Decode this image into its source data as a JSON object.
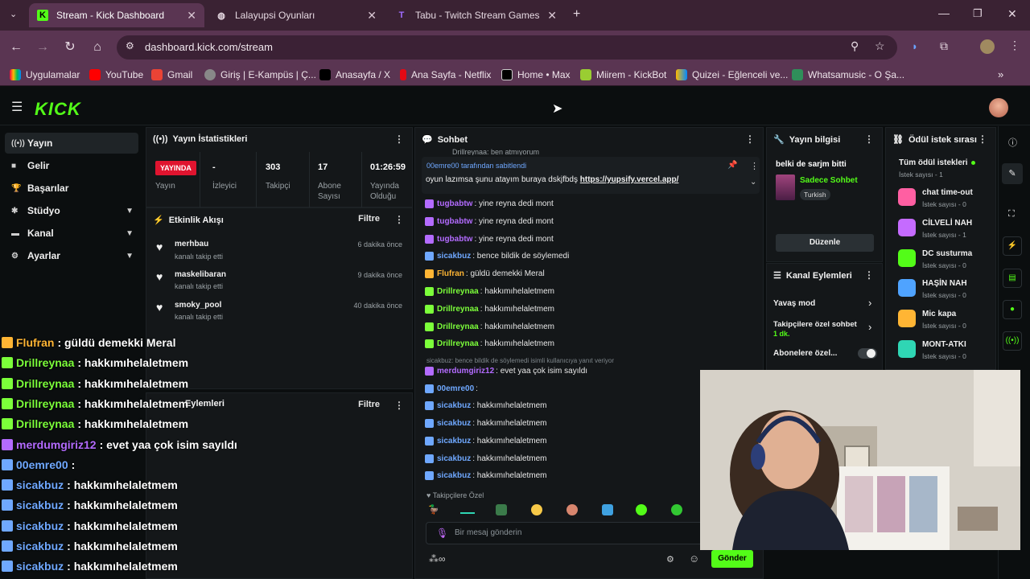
{
  "browser": {
    "tabs": [
      {
        "title": "Stream - Kick Dashboard",
        "active": true
      },
      {
        "title": "Lalayupsi Oyunları",
        "active": false
      },
      {
        "title": "Tabu - Twitch Stream Games",
        "active": false
      }
    ],
    "url": "dashboard.kick.com/stream",
    "bookmarks": [
      "Uygulamalar",
      "YouTube",
      "Gmail",
      "Giriş | E-Kampüs | Ç...",
      "Anasayfa / X",
      "Ana Sayfa - Netflix",
      "Home • Max",
      "Miirem - KickBot",
      "Quizei - Eğlenceli ve...",
      "Whatsamusic - O Şa..."
    ]
  },
  "app": {
    "logo": "KICK",
    "sidebar": [
      {
        "label": "Yayın",
        "active": true,
        "chevron": false
      },
      {
        "label": "Gelir",
        "active": false,
        "chevron": false
      },
      {
        "label": "Başarılar",
        "active": false,
        "chevron": false
      },
      {
        "label": "Stüdyo",
        "active": false,
        "chevron": true
      },
      {
        "label": "Kanal",
        "active": false,
        "chevron": true
      },
      {
        "label": "Ayarlar",
        "active": false,
        "chevron": true
      }
    ],
    "stats": {
      "title": "Yayın İstatistikleri",
      "live_badge": "YAYINDA",
      "live_label": "Yayın",
      "items": [
        {
          "value": "-",
          "label": "İzleyici"
        },
        {
          "value": "303",
          "label": "Takipçi"
        },
        {
          "value": "17",
          "label": "Abone Sayısı"
        },
        {
          "value": "01:26:59",
          "label": "Yayında Olduğu Süre"
        }
      ]
    },
    "activity": {
      "title": "Etkinlik Akışı",
      "filter": "Filtre",
      "items": [
        {
          "user": "merhbau",
          "action": "kanalı takip etti",
          "time": "6 dakika önce"
        },
        {
          "user": "maskelibaran",
          "action": "kanalı takip etti",
          "time": "9 dakika önce"
        },
        {
          "user": "smoky_pool",
          "action": "kanalı takip etti",
          "time": "40 dakika önce"
        }
      ]
    },
    "moderation": {
      "title": "Eylemleri",
      "filter": "Filtre"
    },
    "chat": {
      "title": "Sohbet",
      "top_partial": "Drillreynaa: ben atmıyorum",
      "pinned_by": "00emre00 tarafından sabitlendi",
      "pinned_text": "oyun lazımsa şunu atayım buraya dskjfbdş",
      "pinned_link": "https://yupsify.vercel.app/",
      "messages": [
        {
          "user": "tugbabtw",
          "text": ": yine reyna dedi mont",
          "color": "#b36bff"
        },
        {
          "user": "tugbabtw",
          "text": ": yine reyna dedi mont",
          "color": "#b36bff"
        },
        {
          "user": "tugbabtw",
          "text": ": yine reyna dedi mont",
          "color": "#b36bff"
        },
        {
          "user": "sicakbuz",
          "text": ": bence bildik de söylemedi",
          "color": "#6fa8ff"
        },
        {
          "user": "Flufran",
          "text": ": güldü demekki Meral",
          "color": "#ffb534"
        },
        {
          "user": "Drillreynaa",
          "text": ": hakkımıhelaletmem",
          "color": "#7cff3a"
        },
        {
          "user": "Drillreynaa",
          "text": ": hakkımıhelaletmem",
          "color": "#7cff3a"
        },
        {
          "user": "Drillreynaa",
          "text": ": hakkımıhelaletmem",
          "color": "#7cff3a"
        },
        {
          "user": "Drillreynaa",
          "text": ": hakkımıhelaletmem",
          "color": "#7cff3a"
        }
      ],
      "reply_context": "sicakbuz: bence bildik de söylemedi isimli kullanıcıya yanıt veriyor",
      "messages2": [
        {
          "user": "merdumgiriz12",
          "text": ": evet yaa çok isim sayıldı",
          "color": "#b36bff"
        },
        {
          "user": "00emre00",
          "text": ":",
          "color": "#6fa8ff"
        },
        {
          "user": "sicakbuz",
          "text": ": hakkımıhelaletmem",
          "color": "#6fa8ff"
        },
        {
          "user": "sicakbuz",
          "text": ": hakkımıhelaletmem",
          "color": "#6fa8ff"
        },
        {
          "user": "sicakbuz",
          "text": ": hakkımıhelaletmem",
          "color": "#6fa8ff"
        },
        {
          "user": "sicakbuz",
          "text": ": hakkımıhelaletmem",
          "color": "#6fa8ff"
        },
        {
          "user": "sicakbuz",
          "text": ": hakkımıhelaletmem",
          "color": "#6fa8ff"
        }
      ],
      "followers_only": "Takipçilere Özel",
      "input_placeholder": "Bir mesaj gönderin",
      "send": "Gönder"
    },
    "stream_info": {
      "title": "Yayın bilgisi",
      "stream_title": "belki de sarjm bitti",
      "category": "Sadece Sohbet",
      "tag": "Turkish",
      "edit": "Düzenle"
    },
    "channel_actions": {
      "title": "Kanal Eylemleri",
      "items": [
        "Yavaş mod",
        "Takipçilere özel sohbet",
        "Abonelere özel..."
      ],
      "follow_sub": "1 dk."
    },
    "rewards": {
      "title": "Ödül istek sırası",
      "all": "Tüm ödül istekleri",
      "all_count": "İstek sayısı - 1",
      "items": [
        {
          "name": "chat time-out",
          "count": "İstek sayısı - 0",
          "color": "#ff5fa2"
        },
        {
          "name": "CİLVELİ NAH",
          "count": "İstek sayısı - 1",
          "color": "#c56bff"
        },
        {
          "name": "DC susturma",
          "count": "İstek sayısı - 0",
          "color": "#53fc18"
        },
        {
          "name": "HAŞİN NAH",
          "count": "İstek sayısı - 0",
          "color": "#4fa3ff"
        },
        {
          "name": "Mic kapa",
          "count": "İstek sayısı - 0",
          "color": "#ffb534"
        },
        {
          "name": "MONT-ATKI",
          "count": "İstek sayısı - 0",
          "color": "#2fd6b4"
        }
      ]
    },
    "overlay_chat": [
      {
        "user": "Flufran",
        "text": ": güldü demekki Meral",
        "color": "#ffb534"
      },
      {
        "user": "Drillreynaa",
        "text": ": hakkımıhelaletmem",
        "color": "#7cff3a"
      },
      {
        "user": "Drillreynaa",
        "text": ": hakkımıhelaletmem",
        "color": "#7cff3a"
      },
      {
        "user": "Drillreynaa",
        "text": ": hakkımıhelaletmem",
        "color": "#7cff3a"
      },
      {
        "user": "Drillreynaa",
        "text": ": hakkımıhelaletmem",
        "color": "#7cff3a"
      },
      {
        "user": "merdumgiriz12",
        "text": ": evet yaa çok isim sayıldı",
        "color": "#b36bff"
      },
      {
        "user": "00emre00",
        "text": ":",
        "color": "#6fa8ff"
      },
      {
        "user": "sicakbuz",
        "text": ": hakkımıhelaletmem",
        "color": "#6fa8ff"
      },
      {
        "user": "sicakbuz",
        "text": ": hakkımıhelaletmem",
        "color": "#6fa8ff"
      },
      {
        "user": "sicakbuz",
        "text": ": hakkımıhelaletmem",
        "color": "#6fa8ff"
      },
      {
        "user": "sicakbuz",
        "text": ": hakkımıhelaletmem",
        "color": "#6fa8ff"
      },
      {
        "user": "sicakbuz",
        "text": ": hakkımıhelaletmem",
        "color": "#6fa8ff"
      }
    ],
    "accent": "#53fc18"
  }
}
